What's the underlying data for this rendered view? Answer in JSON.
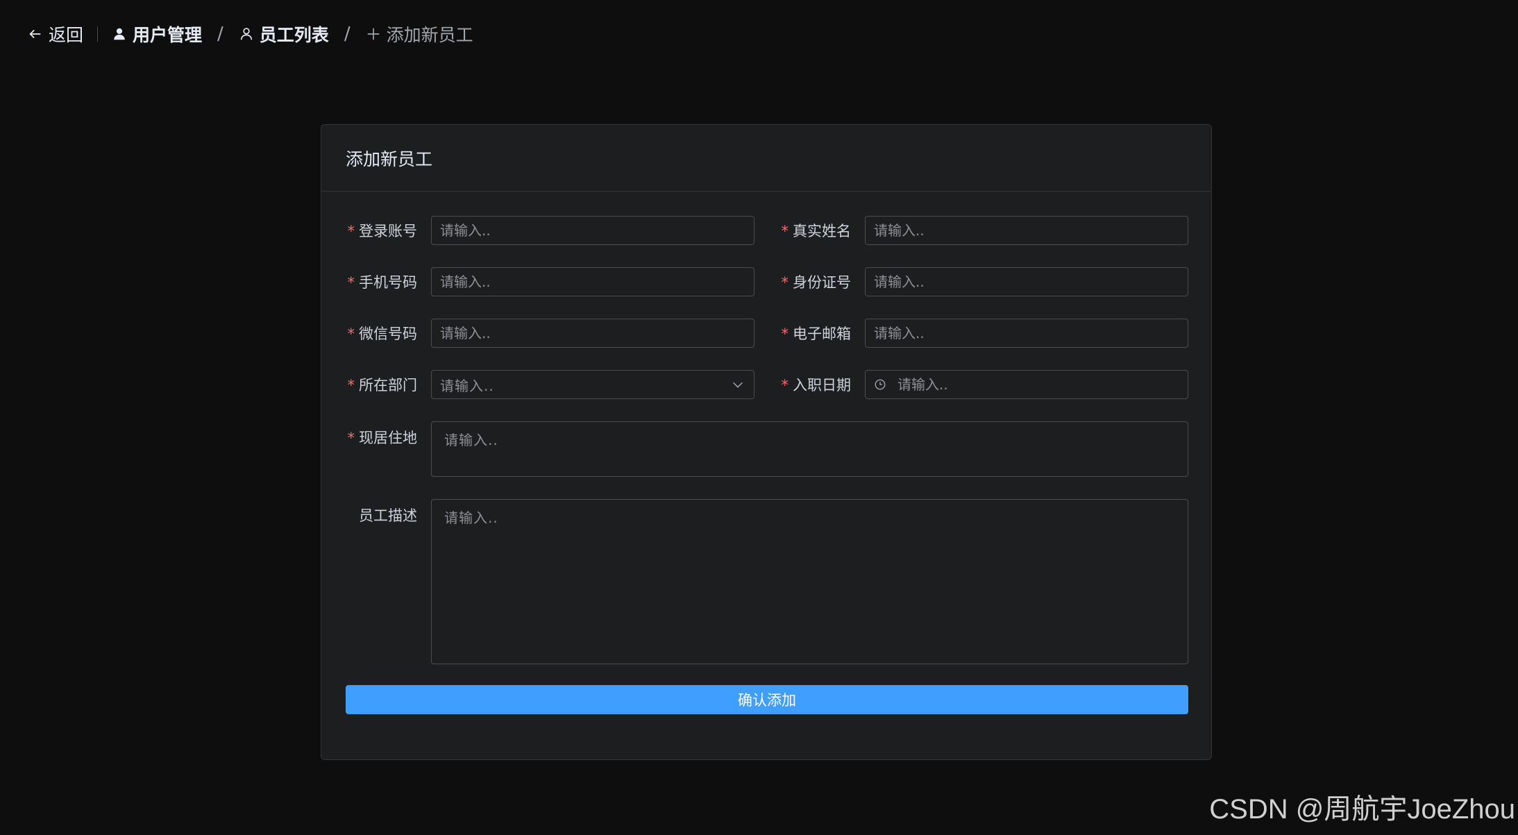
{
  "header": {
    "back_label": "返回",
    "breadcrumb": [
      {
        "label": "用户管理",
        "icon": "user-filled-icon"
      },
      {
        "label": "员工列表",
        "icon": "user-outline-icon"
      },
      {
        "label": "添加新员工",
        "icon": "plus-icon"
      }
    ],
    "separator": "/"
  },
  "card": {
    "title": "添加新员工"
  },
  "form": {
    "required_mark": "*",
    "fields": {
      "login_account": {
        "label": "登录账号",
        "placeholder": "请输入.."
      },
      "real_name": {
        "label": "真实姓名",
        "placeholder": "请输入.."
      },
      "phone": {
        "label": "手机号码",
        "placeholder": "请输入.."
      },
      "id_card": {
        "label": "身份证号",
        "placeholder": "请输入.."
      },
      "wechat": {
        "label": "微信号码",
        "placeholder": "请输入.."
      },
      "email": {
        "label": "电子邮箱",
        "placeholder": "请输入.."
      },
      "department": {
        "label": "所在部门",
        "placeholder": "请输入.."
      },
      "hire_date": {
        "label": "入职日期",
        "placeholder": "请输入.."
      },
      "address": {
        "label": "现居住地",
        "placeholder": "请输入.."
      },
      "description": {
        "label": "员工描述",
        "placeholder": "请输入.."
      }
    },
    "submit_label": "确认添加"
  },
  "watermark": "CSDN @周航宇JoeZhou",
  "colors": {
    "accent": "#409eff",
    "required": "#f56c6c",
    "background": "#0e0e0f",
    "card": "#1d1e1f"
  }
}
